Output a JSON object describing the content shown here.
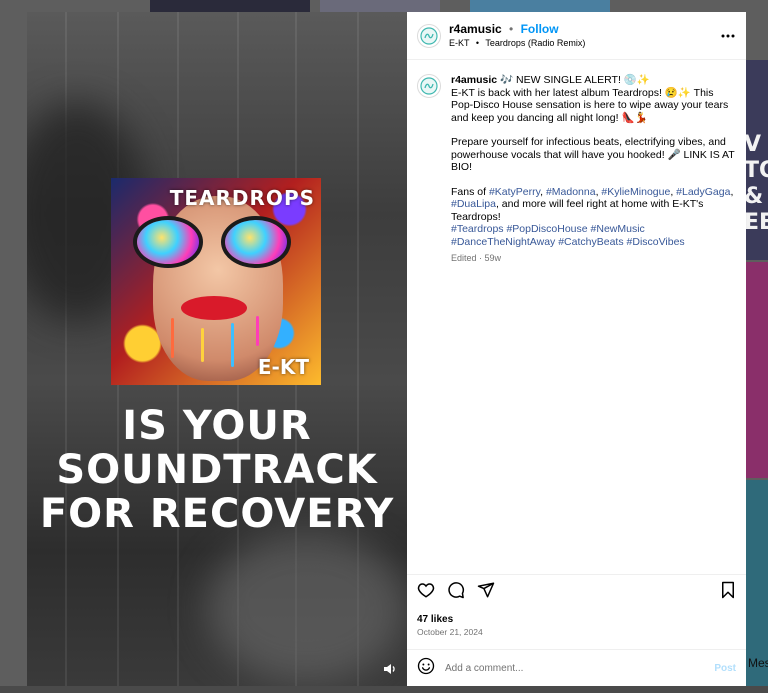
{
  "post": {
    "username": "r4amusic",
    "follow_label": "Follow",
    "dot": "•",
    "audio_artist": "E-KT",
    "audio_track": "Teardrops (Radio Remix)",
    "caption": {
      "line1": "🎶 NEW SINGLE ALERT! 💿✨",
      "line2": "E-KT is back with her latest album Teardrops! 😢✨ This Pop-Disco House sensation is here to wipe away your tears and keep you dancing all night long! 👠💃",
      "para2": "Prepare yourself for infectious beats, electrifying vibes, and powerhouse vocals that will have you hooked! 🎤 LINK IS AT BIO!",
      "para3_prefix": "Fans of ",
      "tags_inline": [
        "#KatyPerry",
        "#Madonna",
        "#KylieMinogue",
        "#LadyGaga",
        "#DuaLipa"
      ],
      "para3_suffix": ", and more will feel right at home with E-KT's Teardrops!",
      "hashtags": [
        "#Teardrops",
        "#PopDiscoHouse",
        "#NewMusic",
        "#DanceTheNightAway",
        "#CatchyBeats",
        "#DiscoVibes"
      ]
    },
    "edited_meta": "Edited · 59w",
    "likes": "47 likes",
    "date": "October 21, 2024",
    "comment_placeholder": "Add a comment...",
    "post_label": "Post"
  },
  "media": {
    "album_title": "TEARDROPS",
    "album_artist": "E-KT",
    "overlay_lines": [
      "IS YOUR",
      "SOUNDTRACK",
      "FOR RECOVERY"
    ]
  },
  "background": {
    "right_text_lines": [
      "V",
      "TO",
      "&",
      "EE!"
    ],
    "right_text_bottom": "Mes"
  },
  "icons": {
    "avatar": "r4a-logo-icon",
    "more": "more-horizontal-icon",
    "like": "heart-icon",
    "comment": "comment-bubble-icon",
    "share": "paper-plane-icon",
    "save": "bookmark-icon",
    "emoji": "emoji-smile-icon",
    "mute": "speaker-icon"
  },
  "colors": {
    "follow": "#0095f6",
    "hashtag": "#385898",
    "post_disabled": "#b2dffc",
    "muted_text": "#737373"
  }
}
